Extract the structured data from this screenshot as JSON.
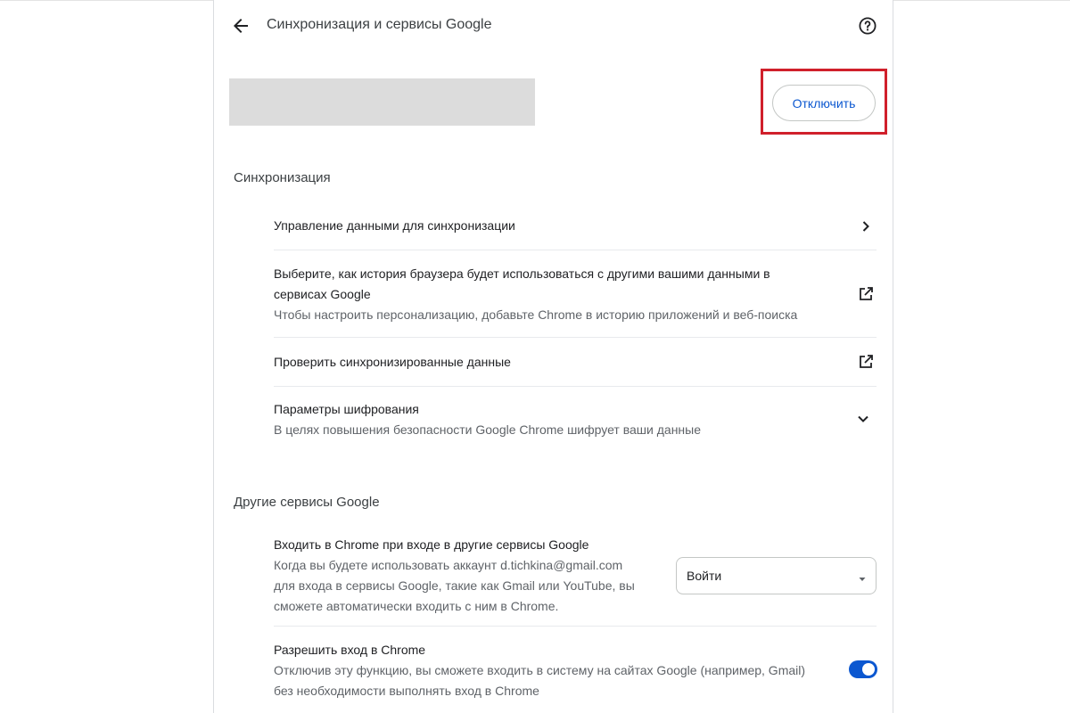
{
  "header": {
    "title": "Синхронизация и сервисы Google",
    "back_icon": "arrow-back-icon",
    "help_icon": "help-circle-icon"
  },
  "account": {
    "disconnect_label": "Отключить"
  },
  "sync_section": {
    "title": "Синхронизация",
    "rows": [
      {
        "title": "Управление данными для синхронизации",
        "icon": "chevron-right-icon"
      },
      {
        "title_line1": "Выберите, как история браузера будет использоваться с другими вашими данными в",
        "title_line2": "сервисах Google",
        "subtitle": "Чтобы настроить персонализацию, добавьте Chrome в историю приложений и веб-поиска",
        "icon": "open-in-new-icon"
      },
      {
        "title": "Проверить синхронизированные данные",
        "icon": "open-in-new-icon"
      },
      {
        "title": "Параметры шифрования",
        "subtitle": "В целях повышения безопасности Google Chrome шифрует ваши данные",
        "icon": "chevron-down-icon"
      }
    ]
  },
  "other_section": {
    "title": "Другие сервисы Google",
    "signin_row": {
      "title": "Входить в Chrome при входе в другие сервисы Google",
      "desc_line1": "Когда вы будете использовать аккаунт d.tichkina@gmail.com",
      "desc_line2": "для входа в сервисы Google, такие как Gmail или YouTube, вы",
      "desc_line3": "сможете автоматически входить с ним в Chrome.",
      "select_value": "Войти"
    },
    "allow_row": {
      "title": "Разрешить вход в Chrome",
      "desc_line1": "Отключив эту функцию, вы сможете входить в систему на сайтах Google (например, Gmail)",
      "desc_line2": "без необходимости выполнять вход в Chrome",
      "toggle_on": true
    }
  },
  "colors": {
    "accent": "#0b57d0",
    "highlight": "#d0202b",
    "placeholder": "#dcdcdc"
  }
}
